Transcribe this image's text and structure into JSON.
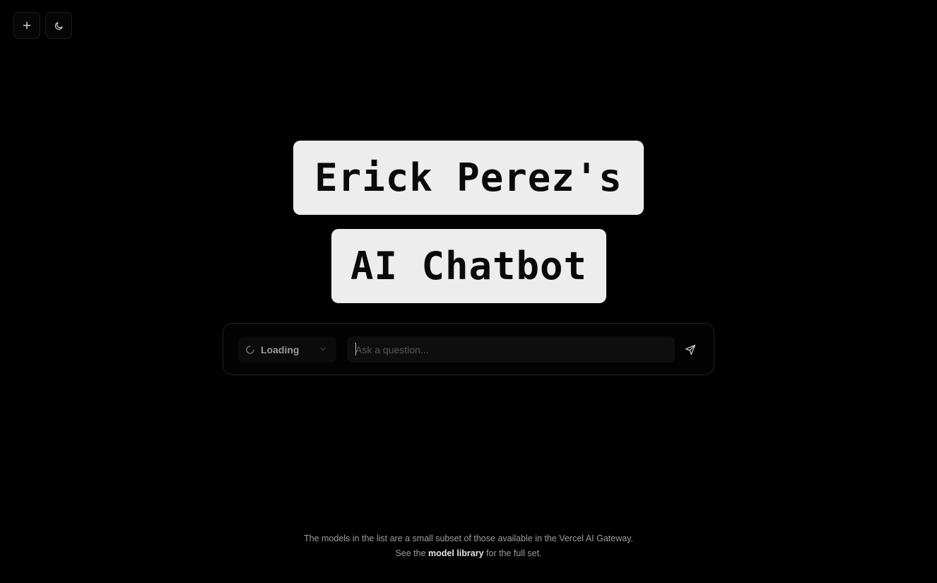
{
  "toolbar": {
    "new_chat_icon": "plus-icon",
    "theme_toggle_icon": "moon-icon"
  },
  "hero": {
    "line1": "Erick Perez's",
    "line2": "AI Chatbot"
  },
  "chat": {
    "model_selector": {
      "status_icon": "spinner-icon",
      "label": "Loading",
      "chevron_icon": "chevron-down-icon"
    },
    "input": {
      "placeholder": "Ask a question...",
      "value": ""
    },
    "send_icon": "send-icon"
  },
  "footer": {
    "line1": "The models in the list are a small subset of those available in the Vercel AI Gateway.",
    "line2_prefix": "See the",
    "line2_link": "model library",
    "line2_suffix": "for the full set."
  },
  "colors": {
    "background": "#000000",
    "title_box": "#ededed",
    "title_text": "#0a0a0a",
    "muted_text": "#9c9c9c",
    "link_text": "#e6e6e6"
  }
}
